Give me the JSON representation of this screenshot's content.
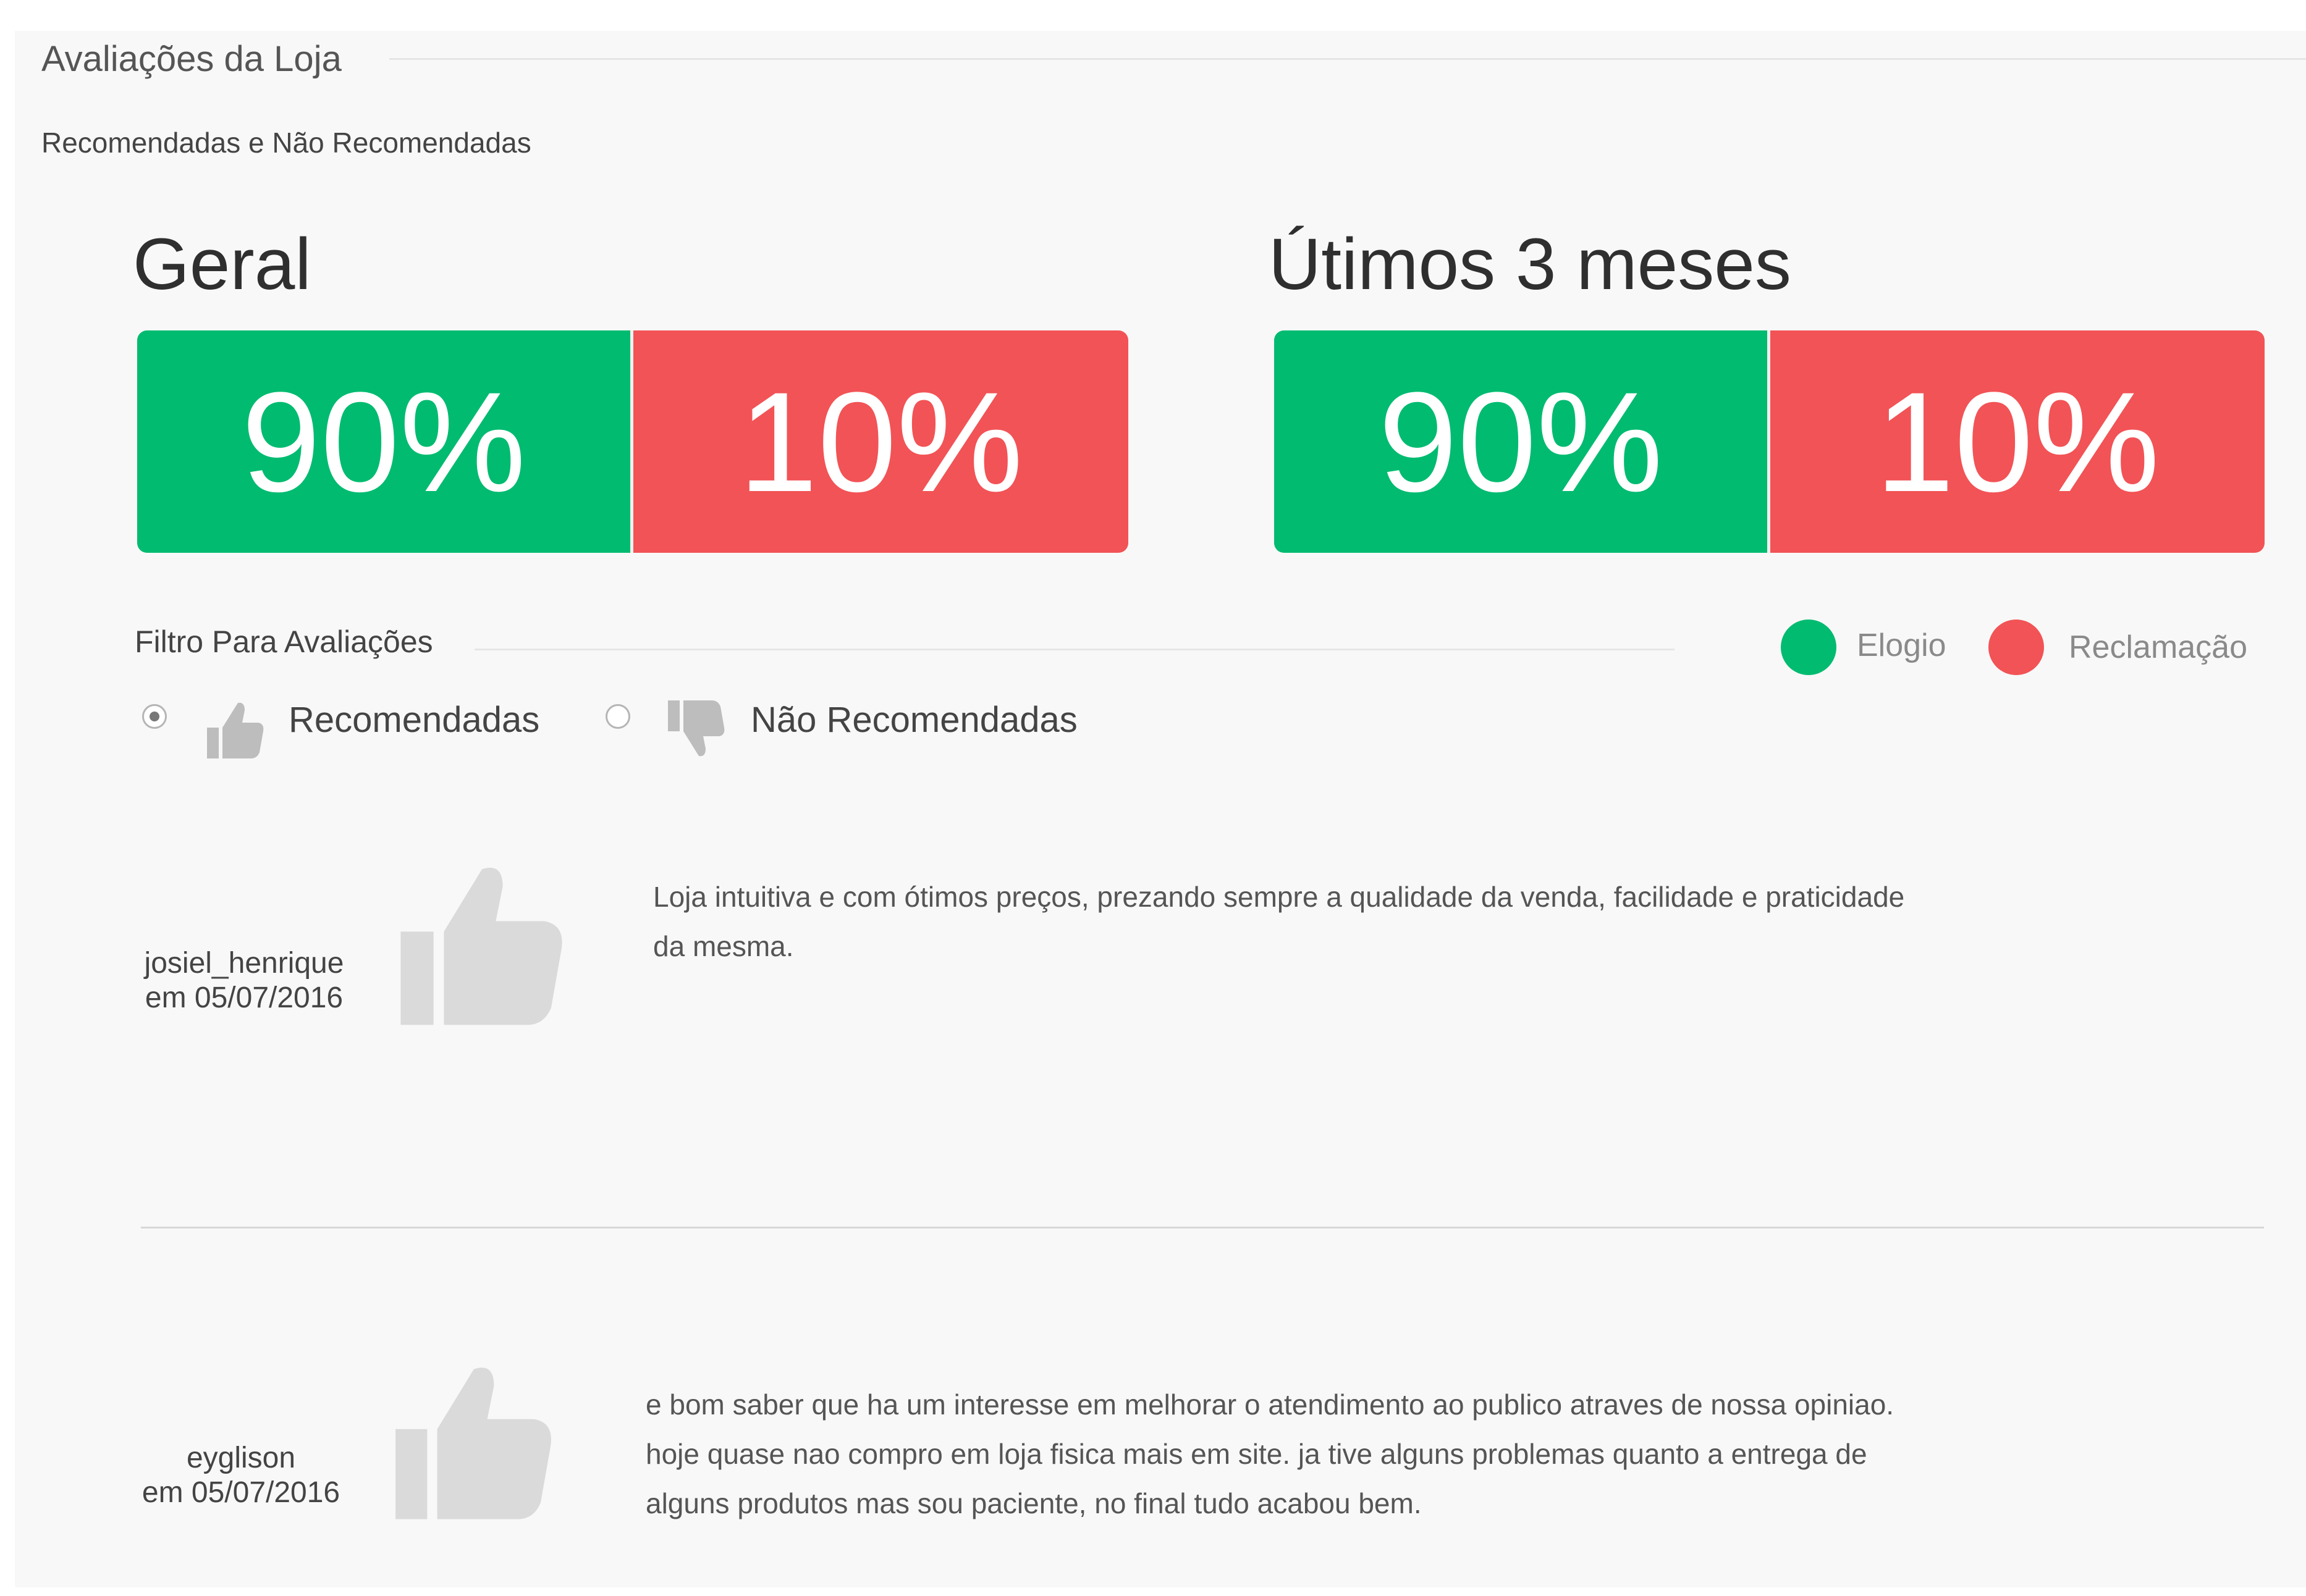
{
  "header": {
    "title": "Avaliações da Loja",
    "subtitle": "Recomendadas e Não Recomendadas"
  },
  "summary": [
    {
      "heading": "Geral",
      "positive_label": "90%",
      "negative_label": "10%",
      "positive_share": 0.5
    },
    {
      "heading": "Útimos 3 meses",
      "positive_label": "90%",
      "negative_label": "10%",
      "positive_share": 0.5
    }
  ],
  "filter": {
    "title": "Filtro Para Avaliações",
    "options": [
      {
        "label": "Recomendadas",
        "selected": true,
        "icon": "thumbs-up-icon"
      },
      {
        "label": "Não Recomendadas",
        "selected": false,
        "icon": "thumbs-down-icon"
      }
    ]
  },
  "legend": [
    {
      "label": "Elogio",
      "color": "#00bb70"
    },
    {
      "label": "Reclamação",
      "color": "#f25356"
    }
  ],
  "reviews": [
    {
      "user": "josiel_henrique",
      "date": "em 05/07/2016",
      "icon": "thumbs-up-icon",
      "text": "Loja intuitiva e com ótimos preços, prezando sempre a qualidade da venda, facilidade e praticidade da mesma."
    },
    {
      "user": "eyglison",
      "date": "em 05/07/2016",
      "icon": "thumbs-up-icon",
      "text": "e bom saber que ha um interesse em melhorar o atendimento ao publico atraves de nossa opiniao. hoje quase nao compro em loja fisica mais em site. ja tive alguns problemas quanto a entrega de alguns produtos mas sou paciente, no final tudo acabou bem."
    }
  ],
  "colors": {
    "positive": "#00bb70",
    "negative": "#f25356",
    "icon_gray": "#dadada"
  }
}
